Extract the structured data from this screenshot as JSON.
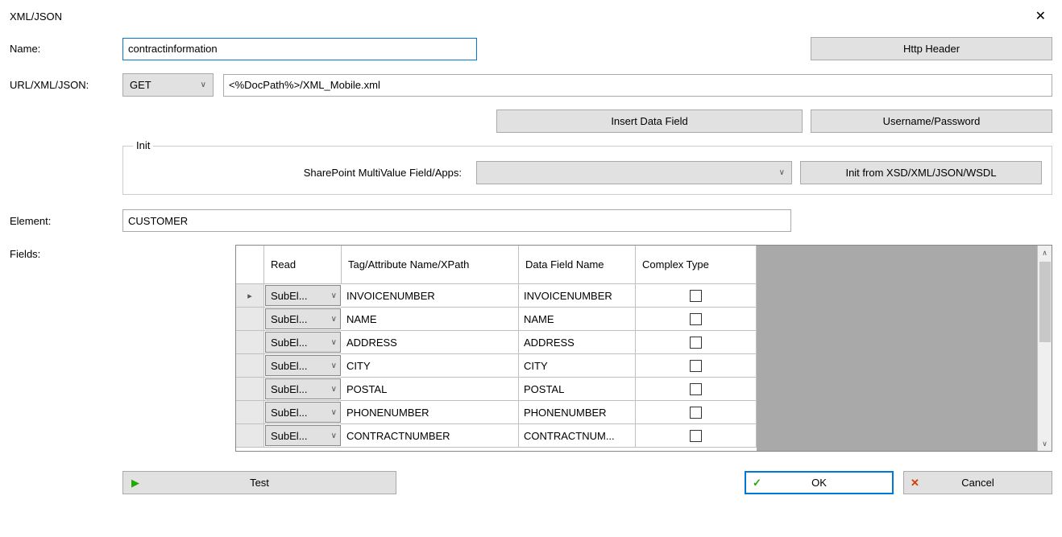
{
  "title": "XML/JSON",
  "labels": {
    "name": "Name:",
    "url": "URL/XML/JSON:",
    "element": "Element:",
    "fields": "Fields:",
    "init_legend": "Init",
    "sp_label": "SharePoint MultiValue Field/Apps:"
  },
  "inputs": {
    "name_value": "contractinformation",
    "method": "GET",
    "url_value": "<%DocPath%>/XML_Mobile.xml",
    "element_value": "CUSTOMER"
  },
  "buttons": {
    "http_header": "Http Header",
    "insert_data": "Insert Data Field",
    "user_pass": "Username/Password",
    "init_from": "Init from XSD/XML/JSON/WSDL",
    "test": "Test",
    "ok": "OK",
    "cancel": "Cancel"
  },
  "grid": {
    "headers": {
      "read": "Read",
      "tag": "Tag/Attribute Name/XPath",
      "dfn": "Data Field Name",
      "ct": "Complex Type"
    },
    "read_combo": "SubEl...",
    "rows": [
      {
        "selected": true,
        "tag": "INVOICENUMBER",
        "dfn": "INVOICENUMBER",
        "complex": false
      },
      {
        "selected": false,
        "tag": "NAME",
        "dfn": "NAME",
        "complex": false
      },
      {
        "selected": false,
        "tag": "ADDRESS",
        "dfn": "ADDRESS",
        "complex": false
      },
      {
        "selected": false,
        "tag": "CITY",
        "dfn": "CITY",
        "complex": false
      },
      {
        "selected": false,
        "tag": "POSTAL",
        "dfn": "POSTAL",
        "complex": false
      },
      {
        "selected": false,
        "tag": "PHONENUMBER",
        "dfn": "PHONENUMBER",
        "complex": false
      },
      {
        "selected": false,
        "tag": "CONTRACTNUMBER",
        "dfn": "CONTRACTNUM...",
        "complex": false
      }
    ]
  }
}
